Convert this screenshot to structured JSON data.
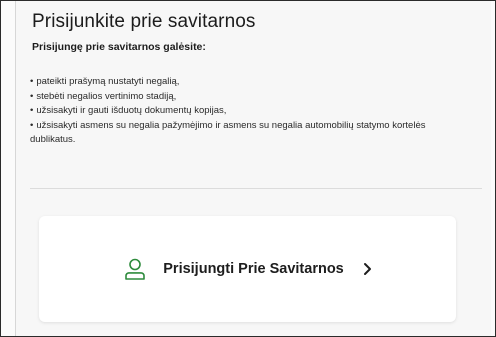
{
  "section": {
    "title": "Prisijunkite prie savitarnos",
    "subtitle": "Prisijungę prie savitarnos galėsite:",
    "benefits": [
      "pateikti prašymą nustatyti negalią,",
      "stebėti negalios vertinimo stadiją,",
      "užsisakyti ir gauti išduotų dokumentų kopijas,",
      "užsisakyti asmens su negalia pažymėjimo ir asmens su negalia automobilių statymo kortelės dublikatus."
    ]
  },
  "login": {
    "label": "Prisijungti Prie Savitarnos",
    "icon": "user-outline-icon",
    "arrow_icon": "chevron-right-icon",
    "icon_color": "#2e8b3d"
  }
}
